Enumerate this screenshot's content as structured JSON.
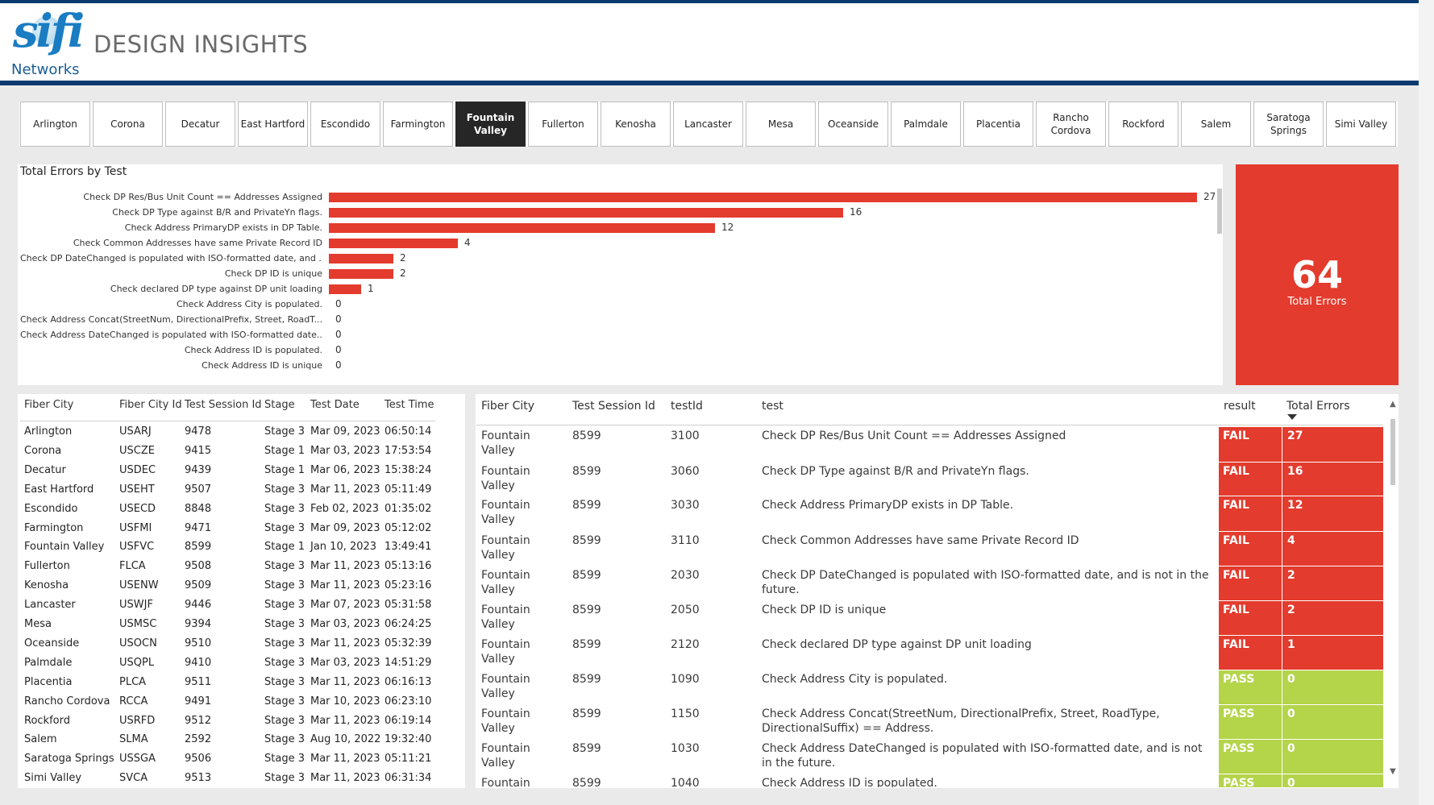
{
  "header": {
    "logo_text": "sifi",
    "logo_sub": "Networks",
    "title": "DESIGN INSIGHTS"
  },
  "tabs": [
    "Arlington",
    "Corona",
    "Decatur",
    "East Hartford",
    "Escondido",
    "Farmington",
    "Fountain Valley",
    "Fullerton",
    "Kenosha",
    "Lancaster",
    "Mesa",
    "Oceanside",
    "Palmdale",
    "Placentia",
    "Rancho Cordova",
    "Rockford",
    "Salem",
    "Saratoga Springs",
    "Simi Valley"
  ],
  "active_tab": "Fountain Valley",
  "chart": {
    "title": "Total Errors by Test",
    "labels": [
      "Check DP Res/Bus Unit Count == Addresses Assigned",
      "Check DP Type against B/R and PrivateYn flags.",
      "Check Address PrimaryDP exists in DP Table.",
      "Check Common Addresses have same Private Record ID",
      "Check DP DateChanged is populated with ISO-formatted date, and ...",
      "Check DP ID is unique",
      "Check declared DP type against DP unit loading",
      "Check Address City is populated.",
      "Check Address Concat(StreetNum, DirectionalPrefix, Street, RoadT...",
      "Check Address DateChanged is populated with ISO-formatted date...",
      "Check Address ID is populated.",
      "Check Address ID is unique"
    ],
    "values_text": [
      "27",
      "16",
      "12",
      "4",
      "2",
      "2",
      "1",
      "0",
      "0",
      "0",
      "0",
      "0"
    ]
  },
  "chart_data": {
    "type": "bar",
    "orientation": "horizontal",
    "title": "Total Errors by Test",
    "categories": [
      "Check DP Res/Bus Unit Count == Addresses Assigned",
      "Check DP Type against B/R and PrivateYn flags.",
      "Check Address PrimaryDP exists in DP Table.",
      "Check Common Addresses have same Private Record ID",
      "Check DP DateChanged is populated with ISO-formatted date, and ...",
      "Check DP ID is unique",
      "Check declared DP type against DP unit loading",
      "Check Address City is populated.",
      "Check Address Concat(StreetNum, DirectionalPrefix, Street, RoadT...",
      "Check Address DateChanged is populated with ISO-formatted date...",
      "Check Address ID is populated.",
      "Check Address ID is unique"
    ],
    "values": [
      27,
      16,
      12,
      4,
      2,
      2,
      1,
      0,
      0,
      0,
      0,
      0
    ],
    "xlim": [
      0,
      27
    ],
    "color": "#e33b2d"
  },
  "kpi": {
    "value": "64",
    "label": "Total Errors"
  },
  "left_table": {
    "headers": [
      "Fiber City",
      "Fiber City Id",
      "Test Session Id",
      "Stage",
      "Test Date",
      "Test Time"
    ],
    "rows": [
      [
        "Arlington",
        "USARJ",
        "9478",
        "Stage 3",
        "Mar 09, 2023",
        "06:50:14"
      ],
      [
        "Corona",
        "USCZE",
        "9415",
        "Stage 1",
        "Mar 03, 2023",
        "17:53:54"
      ],
      [
        "Decatur",
        "USDEC",
        "9439",
        "Stage 1",
        "Mar 06, 2023",
        "15:38:24"
      ],
      [
        "East Hartford",
        "USEHT",
        "9507",
        "Stage 3",
        "Mar 11, 2023",
        "05:11:49"
      ],
      [
        "Escondido",
        "USECD",
        "8848",
        "Stage 3",
        "Feb 02, 2023",
        "01:35:02"
      ],
      [
        "Farmington",
        "USFMI",
        "9471",
        "Stage 3",
        "Mar 09, 2023",
        "05:12:02"
      ],
      [
        "Fountain Valley",
        "USFVC",
        "8599",
        "Stage 1",
        "Jan 10, 2023",
        "13:49:41"
      ],
      [
        "Fullerton",
        "FLCA",
        "9508",
        "Stage 3",
        "Mar 11, 2023",
        "05:13:16"
      ],
      [
        "Kenosha",
        "USENW",
        "9509",
        "Stage 3",
        "Mar 11, 2023",
        "05:23:16"
      ],
      [
        "Lancaster",
        "USWJF",
        "9446",
        "Stage 3",
        "Mar 07, 2023",
        "05:31:58"
      ],
      [
        "Mesa",
        "USMSC",
        "9394",
        "Stage 3",
        "Mar 03, 2023",
        "06:24:25"
      ],
      [
        "Oceanside",
        "USOCN",
        "9510",
        "Stage 3",
        "Mar 11, 2023",
        "05:32:39"
      ],
      [
        "Palmdale",
        "USQPL",
        "9410",
        "Stage 3",
        "Mar 03, 2023",
        "14:51:29"
      ],
      [
        "Placentia",
        "PLCA",
        "9511",
        "Stage 3",
        "Mar 11, 2023",
        "06:16:13"
      ],
      [
        "Rancho Cordova",
        "RCCA",
        "9491",
        "Stage 3",
        "Mar 10, 2023",
        "06:23:10"
      ],
      [
        "Rockford",
        "USRFD",
        "9512",
        "Stage 3",
        "Mar 11, 2023",
        "06:19:14"
      ],
      [
        "Salem",
        "SLMA",
        "2592",
        "Stage 3",
        "Aug 10, 2022",
        "19:32:40"
      ],
      [
        "Saratoga Springs",
        "USSGA",
        "9506",
        "Stage 3",
        "Mar 11, 2023",
        "05:11:21"
      ],
      [
        "Simi Valley",
        "SVCA",
        "9513",
        "Stage 3",
        "Mar 11, 2023",
        "06:31:34"
      ]
    ]
  },
  "right_table": {
    "headers": [
      "Fiber City",
      "Test Session Id",
      "testId",
      "test",
      "result",
      "Total Errors"
    ],
    "rows": [
      [
        "Fountain Valley",
        "8599",
        "3100",
        "Check DP Res/Bus Unit Count == Addresses Assigned",
        "FAIL",
        "27"
      ],
      [
        "Fountain Valley",
        "8599",
        "3060",
        "Check DP Type against B/R and PrivateYn flags.",
        "FAIL",
        "16"
      ],
      [
        "Fountain Valley",
        "8599",
        "3030",
        "Check Address PrimaryDP exists in DP Table.",
        "FAIL",
        "12"
      ],
      [
        "Fountain Valley",
        "8599",
        "3110",
        "Check Common Addresses have same Private Record ID",
        "FAIL",
        "4"
      ],
      [
        "Fountain Valley",
        "8599",
        "2030",
        "Check DP DateChanged is populated with ISO-formatted date, and is not in the future.",
        "FAIL",
        "2"
      ],
      [
        "Fountain Valley",
        "8599",
        "2050",
        "Check DP ID is unique",
        "FAIL",
        "2"
      ],
      [
        "Fountain Valley",
        "8599",
        "2120",
        "Check declared DP type against DP unit loading",
        "FAIL",
        "1"
      ],
      [
        "Fountain Valley",
        "8599",
        "1090",
        "Check Address City is populated.",
        "PASS",
        "0"
      ],
      [
        "Fountain Valley",
        "8599",
        "1150",
        "Check Address Concat(StreetNum, DirectionalPrefix, Street, RoadType, DirectionalSuffix) == Address.",
        "PASS",
        "0"
      ],
      [
        "Fountain Valley",
        "8599",
        "1030",
        "Check Address DateChanged is populated with ISO-formatted date, and is not in the future.",
        "PASS",
        "0"
      ],
      [
        "Fountain Valley",
        "8599",
        "1040",
        "Check Address ID is populated.",
        "PASS",
        "0"
      ]
    ]
  },
  "colors": {
    "fail": "#e33b2d",
    "pass": "#b4d44a",
    "brand": "#0b3a6e"
  }
}
